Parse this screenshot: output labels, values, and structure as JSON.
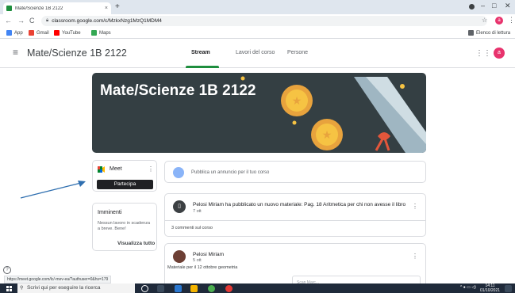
{
  "browser": {
    "tab_title": "Mate/Scienze 1B 2122",
    "new_tab": "+",
    "tab_close": "×",
    "url": "classroom.google.com/c/MzkxNzg1MzQ1MDM4",
    "bookmarks": [
      "App",
      "Gmail",
      "YouTube",
      "Maps"
    ],
    "reading_list": "Elenco di lettura",
    "profile_initial": "a"
  },
  "header": {
    "title": "Mate/Scienze 1B 2122",
    "tabs": [
      "Stream",
      "Lavori del corso",
      "Persone"
    ],
    "active_tab": "Stream",
    "avatar_initial": "a"
  },
  "banner": {
    "title": "Mate/Scienze 1B 2122"
  },
  "meet": {
    "label": "Meet",
    "join_button": "Partecipa"
  },
  "upcoming": {
    "title": "Imminenti",
    "text": "Nessun lavoro in scadenza a breve. Bene!",
    "view_all": "Visualizza tutto"
  },
  "stream": {
    "announce_placeholder": "Pubblica un annuncio per il tuo corso",
    "posts": [
      {
        "text": "Pelosi Miriam ha pubblicato un nuovo materiale: Pag. 18 Aritmetica per chi non avesse il libro",
        "time": "7 ott",
        "comments": "3 commenti sul corso"
      },
      {
        "author": "Pelosi Miriam",
        "time": "5 ott",
        "body": "Materiale per il 12 ottobre geometria",
        "attachment": "Scan Marc..."
      }
    ]
  },
  "status_url": "https://meet.google.com/lc/-mev-ea/?authuser=0&hs=179",
  "taskbar": {
    "search_placeholder": "Scrivi qui per eseguire la ricerca",
    "time": "14:11",
    "date": "01/10/2021"
  },
  "colors": {
    "accent": "#1e8e3e",
    "banner_bg": "#343f43",
    "avatar": "#e8336d",
    "arrow": "#2f6fb0"
  }
}
